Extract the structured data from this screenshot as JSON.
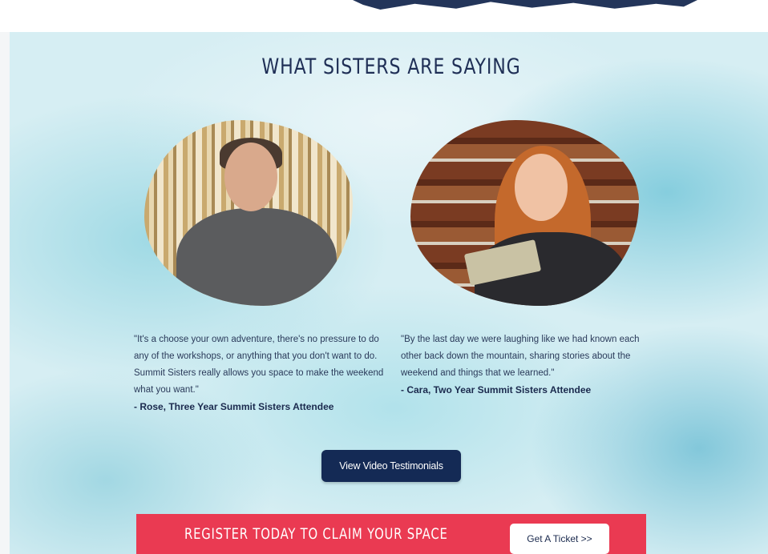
{
  "section": {
    "title": "WHAT SISTERS ARE SAYING"
  },
  "testimonials": [
    {
      "quote": "\"It's a choose your own adventure, there's no pressure to do any of the workshops, or anything that you don't want to do. Summit Sisters really allows you space to make the weekend what you want.\"",
      "attribution": "- Rose, Three Year Summit Sisters Attendee"
    },
    {
      "quote": "\"By the last day we were laughing like we had known each other back down the mountain, sharing stories about the weekend and things that we learned.\"",
      "attribution": "- Cara, Two Year Summit Sisters Attendee"
    }
  ],
  "video_button_label": "View Video Testimonials",
  "register_banner": {
    "text": "REGISTER TODAY TO CLAIM YOUR SPACE",
    "button_label": "Get A Ticket >>"
  }
}
